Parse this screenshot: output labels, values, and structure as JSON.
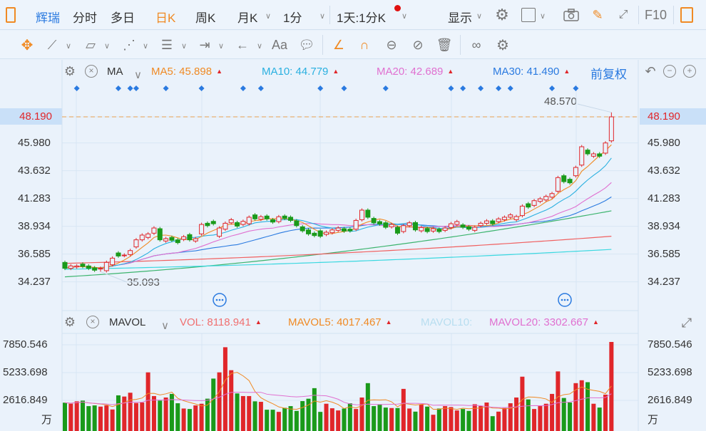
{
  "toolbar": {
    "stock_name": "辉瑞",
    "tabs": [
      "分时",
      "多日",
      "日K",
      "周K",
      "月K",
      "1分"
    ],
    "active_tab": "日K",
    "period_select": "1天:1分K",
    "display_label": "显示",
    "f10_label": "F10"
  },
  "draw_tools": [
    "move-icon",
    "line-icon",
    "polygon-icon",
    "wave-icon",
    "fibonacci-icon",
    "range-icon",
    "arrow-icon",
    "text-icon",
    "comment-icon",
    "angle-icon",
    "arc-icon",
    "cycle-icon",
    "hide-icon",
    "delete-icon",
    "overlay-icon",
    "settings-icon"
  ],
  "text_tool_label": "Aa",
  "main_header": {
    "indicator": "MA",
    "ma5": "MA5: 45.898",
    "ma10": "MA10: 44.779",
    "ma20": "MA20: 42.689",
    "ma30": "MA30: 41.490",
    "adjust": "前复权"
  },
  "vol_header": {
    "indicator": "MAVOL",
    "vol": "VOL: 8118.941",
    "mavol5": "MAVOL5: 4017.467",
    "mavol10": "MAVOL10:",
    "mavol20": "MAVOL20: 3302.667"
  },
  "colors": {
    "up": "#e0262a",
    "down": "#1a9a1a",
    "ma5": "#f08a24",
    "ma10": "#2ab0e0",
    "ma20": "#e070d0",
    "ma30": "#2a7ae0",
    "accent": "#2a7ae0"
  },
  "chart_data": {
    "type": "candlestick",
    "price_ticks": [
      "48.190",
      "45.980",
      "43.632",
      "41.283",
      "38.934",
      "36.585",
      "34.237"
    ],
    "price_tick_values": [
      48.19,
      45.98,
      43.632,
      41.283,
      38.934,
      36.585,
      34.237
    ],
    "current_price": "48.190",
    "high_label": "48.570",
    "low_label": "35.093",
    "high_value": 48.57,
    "low_value": 35.093,
    "vol_ticks": [
      "7850.546",
      "5233.698",
      "2616.849"
    ],
    "vol_tick_values": [
      7850.546,
      5233.698,
      2616.849
    ],
    "vol_unit": "万",
    "event_marker_indices": [
      2,
      9,
      11,
      12,
      17,
      23,
      30,
      33,
      43,
      47,
      54,
      65,
      67,
      70,
      73,
      75,
      82,
      86
    ],
    "oc": [
      [
        35.88,
        35.38
      ],
      [
        35.38,
        35.58
      ],
      [
        35.5,
        35.58
      ],
      [
        35.74,
        35.54
      ],
      [
        35.58,
        35.38
      ],
      [
        35.42,
        35.22
      ],
      [
        35.35,
        35.38
      ],
      [
        35.18,
        35.88
      ],
      [
        35.68,
        36.24
      ],
      [
        36.68,
        36.42
      ],
      [
        36.46,
        36.5
      ],
      [
        36.54,
        36.88
      ],
      [
        37.19,
        37.79
      ],
      [
        37.79,
        38.19
      ],
      [
        37.99,
        38.29
      ],
      [
        38.35,
        38.79
      ],
      [
        38.73,
        37.79
      ],
      [
        37.69,
        37.89
      ],
      [
        37.99,
        37.75
      ],
      [
        37.79,
        37.55
      ],
      [
        37.83,
        38.05
      ],
      [
        38.23,
        37.79
      ],
      [
        37.69,
        37.89
      ],
      [
        38.29,
        39.09
      ],
      [
        39.19,
        38.99
      ],
      [
        39.35,
        39.15
      ],
      [
        38.09,
        38.79
      ],
      [
        38.69,
        39.19
      ],
      [
        39.23,
        39.49
      ],
      [
        39.25,
        38.95
      ],
      [
        39.09,
        39.35
      ],
      [
        39.15,
        39.7
      ],
      [
        39.9,
        39.56
      ],
      [
        39.53,
        39.74
      ],
      [
        39.8,
        39.56
      ],
      [
        39.49,
        39.29
      ],
      [
        39.33,
        39.74
      ],
      [
        39.8,
        39.6
      ],
      [
        39.7,
        39.43
      ],
      [
        39.39,
        38.99
      ],
      [
        38.89,
        38.55
      ],
      [
        38.63,
        38.29
      ],
      [
        38.35,
        38.15
      ],
      [
        38.55,
        38.09
      ],
      [
        38.25,
        38.43
      ],
      [
        38.39,
        38.63
      ],
      [
        38.59,
        38.79
      ],
      [
        38.73,
        38.53
      ],
      [
        38.69,
        38.55
      ],
      [
        38.69,
        39.43
      ],
      [
        39.49,
        40.3
      ],
      [
        40.3,
        39.7
      ],
      [
        39.6,
        39.23
      ],
      [
        39.33,
        39.13
      ],
      [
        39.23,
        38.85
      ],
      [
        38.89,
        39.09
      ],
      [
        38.85,
        38.35
      ],
      [
        38.49,
        38.99
      ],
      [
        38.99,
        39.23
      ],
      [
        39.25,
        38.63
      ],
      [
        38.55,
        38.83
      ],
      [
        38.75,
        38.49
      ],
      [
        38.53,
        38.73
      ],
      [
        38.69,
        38.49
      ],
      [
        38.59,
        38.79
      ],
      [
        38.83,
        39.15
      ],
      [
        39.09,
        39.33
      ],
      [
        39.05,
        38.85
      ],
      [
        38.89,
        38.69
      ],
      [
        38.59,
        38.85
      ],
      [
        38.99,
        39.19
      ],
      [
        39.19,
        39.39
      ],
      [
        39.39,
        39.15
      ],
      [
        39.33,
        39.56
      ],
      [
        39.49,
        39.7
      ],
      [
        39.7,
        39.9
      ],
      [
        39.49,
        39.76
      ],
      [
        39.84,
        40.64
      ],
      [
        40.84,
        40.56
      ],
      [
        40.7,
        41.1
      ],
      [
        41.04,
        41.26
      ],
      [
        41.16,
        41.46
      ],
      [
        41.4,
        41.7
      ],
      [
        41.9,
        43.05
      ],
      [
        43.21,
        42.71
      ],
      [
        42.91,
        42.61
      ],
      [
        43.21,
        43.91
      ],
      [
        44.11,
        45.66
      ],
      [
        45.38,
        45.06
      ],
      [
        44.86,
        45.06
      ],
      [
        45.06,
        44.86
      ],
      [
        45.12,
        45.98
      ],
      [
        46.16,
        48.19
      ]
    ],
    "volume": [
      2400,
      2300,
      2526,
      2593,
      2075,
      2142,
      2030,
      2142,
      1759,
      3089,
      2977,
      3337,
      2368,
      2413,
      5254,
      3022,
      2593,
      2886,
      3225,
      2345,
      1849,
      1804,
      2142,
      2300,
      2774,
      4668,
      5254,
      7622,
      5457,
      3270,
      3022,
      3022,
      2526,
      2481,
      1736,
      1736,
      1533,
      1917,
      2075,
      1624,
      2548,
      2774,
      3766,
      1533,
      2300,
      1872,
      1669,
      1849,
      2345,
      1804,
      2886,
      4239,
      2075,
      2255,
      1939,
      1894,
      1894,
      3698,
      1849,
      1556,
      2210,
      2030,
      1263,
      1849,
      2075,
      1984,
      1669,
      1804,
      1624,
      2255,
      2075,
      2413,
      1128,
      1556,
      1894,
      2345,
      2886,
      4848,
      2706,
      1804,
      2075,
      2300,
      3225,
      5344,
      2841,
      2413,
      4239,
      4510,
      4330,
      2300,
      1939,
      3157,
      8119
    ],
    "long_ma": [
      {
        "name": "green",
        "color": "#3cb46e",
        "start": 34.66,
        "end": 40.24
      },
      {
        "name": "red",
        "color": "#f06060",
        "start": 35.8,
        "end": 38.09
      },
      {
        "name": "cyan",
        "color": "#3ad8e0",
        "start": 35.3,
        "end": 36.98
      }
    ]
  }
}
